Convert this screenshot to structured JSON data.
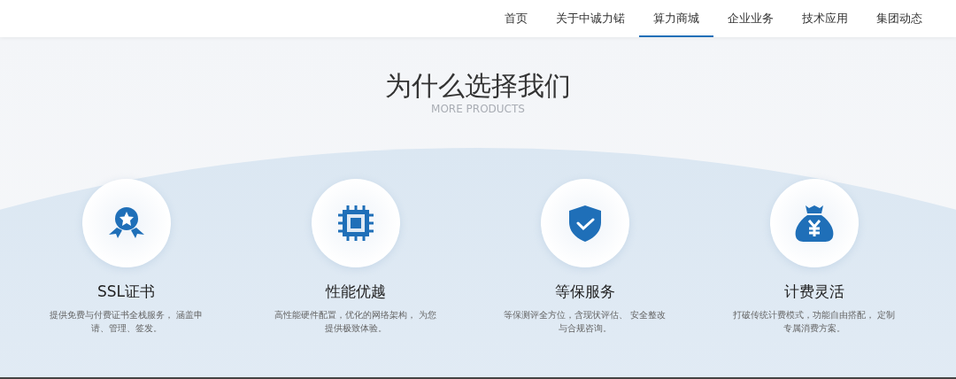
{
  "nav": {
    "items": [
      {
        "label": "首页",
        "selected": false
      },
      {
        "label": "关于中诚力锘",
        "selected": false
      },
      {
        "label": "算力商城",
        "selected": true
      },
      {
        "label": "企业业务",
        "selected": false
      },
      {
        "label": "技术应用",
        "selected": false
      },
      {
        "label": "集团动态",
        "selected": false
      }
    ]
  },
  "section": {
    "title": "为什么选择我们",
    "subtitle": "MORE PRODUCTS",
    "features": [
      {
        "kind": "certificate",
        "title": "SSL证书",
        "description": "提供免费与付费证书全栈服务， 涵盖申请、管理、签发。"
      },
      {
        "kind": "chip",
        "title": "性能优越",
        "description": "高性能硬件配置，优化的网络架构， 为您提供极致体验。"
      },
      {
        "kind": "shield",
        "title": "等保服务",
        "description": "等保测评全方位，含现状评估、 安全整改与合规咨询。"
      },
      {
        "kind": "money",
        "title": "计费灵活",
        "description": "打破传统计费模式，功能自由搭配， 定制专属消费方案。"
      }
    ]
  }
}
